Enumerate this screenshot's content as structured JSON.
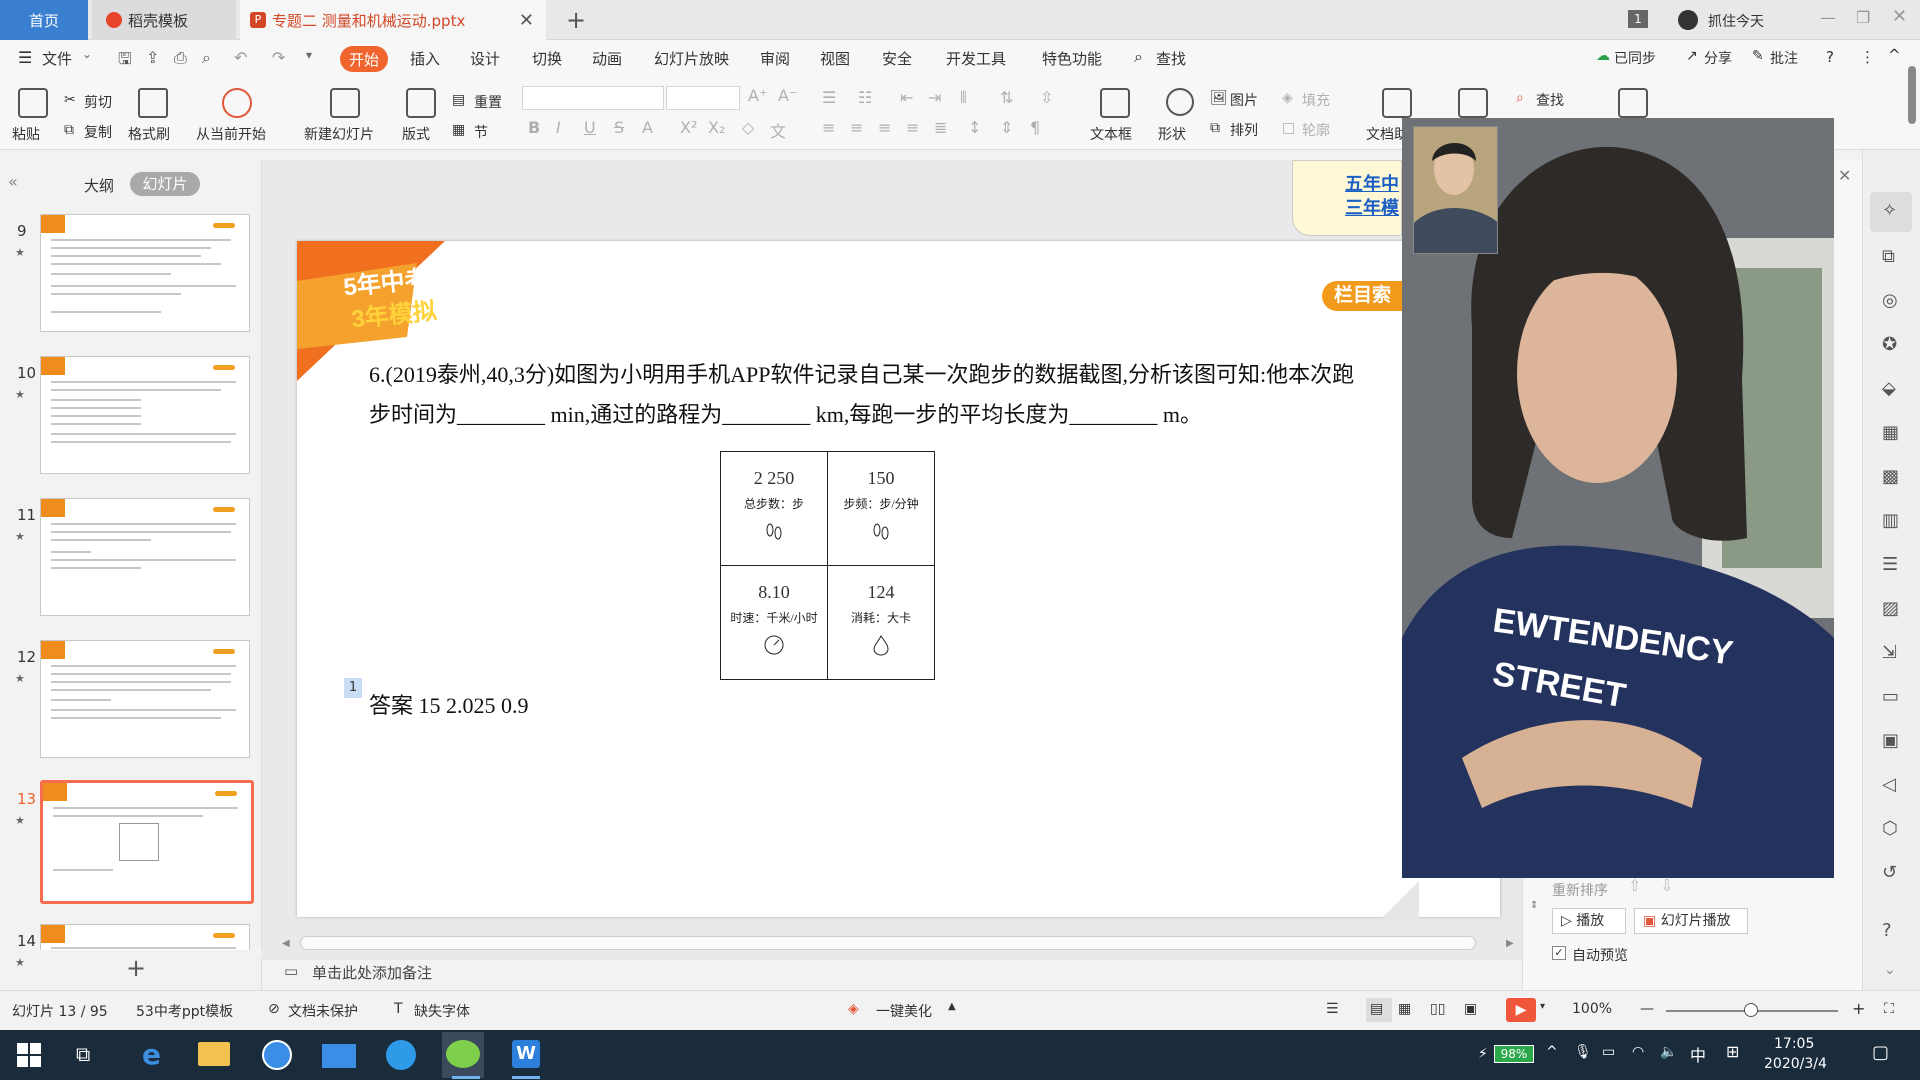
{
  "titlebar": {
    "tabs": [
      {
        "label": "首页"
      },
      {
        "label": "稻壳模板"
      },
      {
        "label": "专题二 测量和机械运动.pptx"
      }
    ],
    "badge": "1",
    "user": "抓住今天"
  },
  "menu": {
    "file": "文件",
    "items": [
      "开始",
      "插入",
      "设计",
      "切换",
      "动画",
      "幻灯片放映",
      "审阅",
      "视图",
      "安全",
      "开发工具",
      "特色功能"
    ],
    "search": "查找",
    "right": [
      "已同步",
      "分享",
      "批注"
    ]
  },
  "ribbon": {
    "paste": "粘贴",
    "cut": "剪切",
    "copy": "复制",
    "format_painter": "格式刷",
    "from_current": "从当前开始",
    "new_slide": "新建幻灯片",
    "layout": "版式",
    "reset": "重置",
    "section": "节",
    "textbox": "文本框",
    "shape": "形状",
    "picture": "图片",
    "fill": "填充",
    "arrange": "排列",
    "outline": "轮廓",
    "find": "查找",
    "doc_assist": "文档助"
  },
  "leftpanel": {
    "tab_outline": "大纲",
    "tab_slides": "幻灯片",
    "thumbs": [
      {
        "num": "9"
      },
      {
        "num": "10"
      },
      {
        "num": "11"
      },
      {
        "num": "12"
      },
      {
        "num": "13"
      },
      {
        "num": "14"
      }
    ]
  },
  "slide": {
    "logo_line1": "5年中考",
    "logo_line2": "3年模拟",
    "nav_badge": "栏目索",
    "question_line1": "6.(2019泰州,40,3分)如图为小明用手机APP软件记录自己某一次跑步的数据截图,分析该图可知:他本次跑",
    "question_line2": "步时间为________ min,通过的路程为________ km,每跑一步的平均长度为________ m。",
    "cells": [
      {
        "value": "2 250",
        "label": "总步数：步",
        "icon": "footprints-icon"
      },
      {
        "value": "150",
        "label": "步频：步/分钟",
        "icon": "footprints-icon"
      },
      {
        "value": "8.10",
        "label": "时速：千米/小时",
        "icon": "speedometer-icon"
      },
      {
        "value": "124",
        "label": "消耗：大卡",
        "icon": "flame-icon"
      }
    ],
    "marker": "1",
    "answer": "答案    15    2.025    0.9"
  },
  "popup": {
    "line1": "五年中",
    "line2": "三年模"
  },
  "video": {
    "shirt_text1": "EWTENDENCY",
    "shirt_text2": "STREET"
  },
  "right_panel": {
    "reorder": "重新排序",
    "play": "播放",
    "slideshow": "幻灯片播放",
    "auto_preview": "自动预览"
  },
  "notes": {
    "placeholder": "单击此处添加备注"
  },
  "statusbar": {
    "slide_pos": "幻灯片 13 / 95",
    "template": "53中考ppt模板",
    "protect": "文档未保护",
    "missing_font": "缺失字体",
    "beautify": "一键美化",
    "zoom": "100%"
  },
  "taskbar": {
    "battery": "98%",
    "ime": "中",
    "time": "17:05",
    "date": "2020/3/4"
  },
  "colors": {
    "accent": "#f0642d",
    "home_tab": "#3a7fd0",
    "taskbar": "#1a2b3c"
  }
}
